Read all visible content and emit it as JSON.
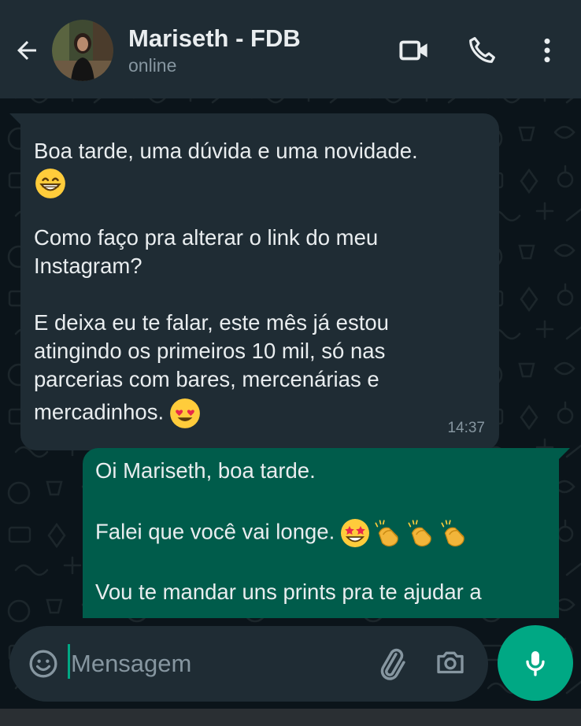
{
  "header": {
    "contact_name": "Mariseth - FDB",
    "status": "online",
    "back_icon": "arrow-left-icon",
    "video_icon": "videocam-icon",
    "call_icon": "phone-icon",
    "menu_icon": "more-vert-icon"
  },
  "messages": [
    {
      "direction": "incoming",
      "lines": [
        "Boa tarde, uma dúvida e uma novidade.",
        "",
        "",
        "Como faço pra alterar o link do meu",
        "Instagram?",
        "",
        "E deixa eu te falar, este mês já estou",
        "atingindo os primeiros 10 mil, só nas",
        "parcerias com bares, mercenárias e",
        "mercadinhos."
      ],
      "emojis": [
        "grinning-face-emoji",
        "heart-eyes-emoji"
      ],
      "time": "14:37"
    },
    {
      "direction": "outgoing",
      "lines": [
        "Oi Mariseth, boa tarde.",
        "",
        "Falei que você vai longe.",
        "",
        "Vou te mandar uns prints pra te ajudar a"
      ],
      "emojis": [
        "star-struck-emoji",
        "clapping-hands-emoji",
        "clapping-hands-emoji",
        "clapping-hands-emoji"
      ]
    }
  ],
  "composer": {
    "placeholder": "Mensagem",
    "emoji_icon": "emoji-icon",
    "attach_icon": "paperclip-icon",
    "camera_icon": "camera-icon",
    "mic_icon": "microphone-icon"
  },
  "colors": {
    "background": "#0b141a",
    "header": "#1f2c34",
    "incoming_bubble": "#1f2c34",
    "outgoing_bubble": "#005c4b",
    "accent": "#00a884",
    "text_primary": "#e9edef",
    "text_secondary": "#8696a0"
  }
}
